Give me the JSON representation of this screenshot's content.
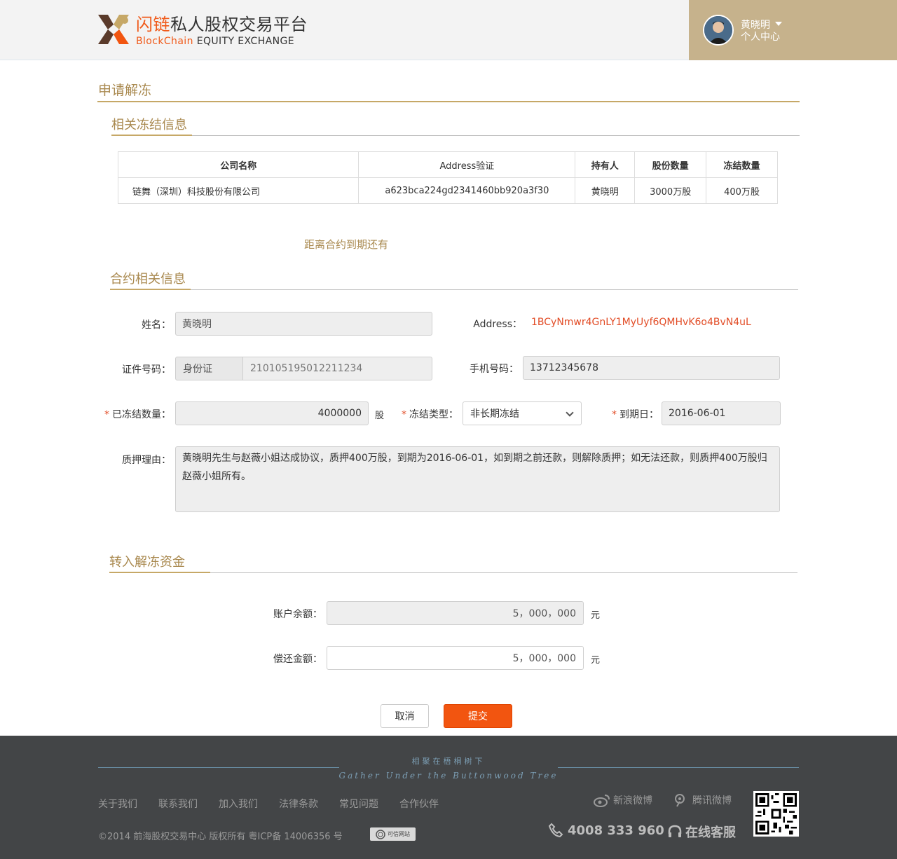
{
  "header": {
    "logo_cn_highlight": "闪链",
    "logo_cn_rest": "私人股权交易平台",
    "logo_en_highlight": "BlockChain",
    "logo_en_rest": " EQUITY EXCHANGE",
    "user_name": "黄晓明",
    "user_center": "个人中心"
  },
  "page": {
    "title": "申请解冻",
    "section_freeze": "相关冻结信息",
    "countdown": "距离合约到期还有",
    "section_contract": "合约相关信息",
    "section_transfer": "转入解冻资金"
  },
  "freeze_table": {
    "headers": [
      "公司名称",
      "Address验证",
      "持有人",
      "股份数量",
      "冻结数量"
    ],
    "row": [
      "链舞（深圳）科技股份有限公司",
      "a623bca224gd2341460bb920a3f30",
      "黄晓明",
      "3000万股",
      "400万股"
    ]
  },
  "form": {
    "name_label": "姓名：",
    "name_value": "黄晓明",
    "address_label": "Address：",
    "address_value": "1BCyNmwr4GnLY1MyUyf6QMHvK6o4BvN4uL",
    "id_label": "证件号码：",
    "id_type": "身份证",
    "id_number": "210105195012211234",
    "phone_label": "手机号码：",
    "phone_value": "13712345678",
    "required_mark": "*",
    "frozen_qty_label": "已冻结数量：",
    "frozen_qty_value": "4000000",
    "frozen_qty_unit": "股",
    "freeze_type_label": "冻结类型：",
    "freeze_type_value": "非长期冻结",
    "due_label": "到期日：",
    "due_value": "2016-06-01",
    "reason_label": "质押理由：",
    "reason_value": "黄晓明先生与赵薇小姐达成协议，质押400万股，到期为2016-06-01，如到期之前还款，则解除质押；如无法还款，则质押400万股归赵薇小姐所有。"
  },
  "transfer": {
    "balance_label": "账户余额：",
    "balance_value": "5，000，000",
    "balance_unit": "元",
    "repay_label": "偿还金额：",
    "repay_value": "5，000，000",
    "repay_unit": "元"
  },
  "actions": {
    "cancel": "取消",
    "submit": "提交"
  },
  "footer": {
    "slogan_cn": "相聚在梧桐树下",
    "slogan_en": "Gather Under the Buttonwood Tree",
    "links": [
      "关于我们",
      "联系我们",
      "加入我们",
      "法律条款",
      "常见问题",
      "合作伙伴"
    ],
    "copyright": "©2014 前海股权交易中心 版权所有   粤ICP备 14006356 号",
    "badge": "可信网站",
    "weibo_sina": "新浪微博",
    "weibo_tencent": "腾讯微博",
    "phone": "4008 333 960",
    "service": "在线客服"
  },
  "colors": {
    "accent_gold": "#c6a867",
    "brand_orange": "#f25510",
    "alert_red": "#e24c26"
  }
}
